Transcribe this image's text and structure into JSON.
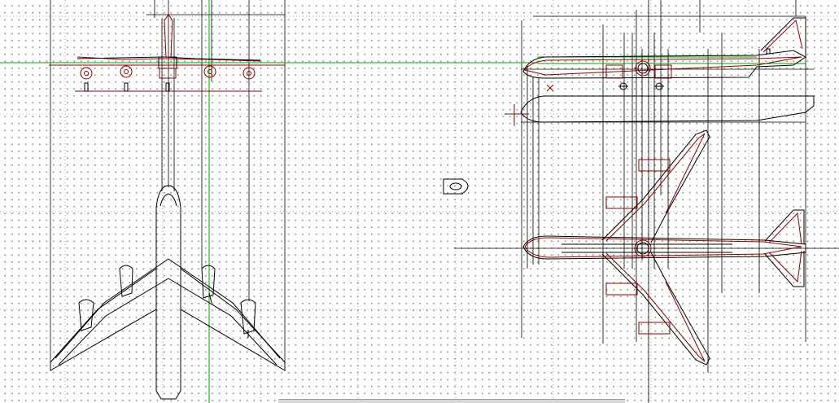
{
  "viewport": {
    "background": "#ffffff",
    "grid_color": "#9a9a9a",
    "line_colors": {
      "outline": "#000000",
      "model": "#8b0000",
      "axis": "#00a000"
    },
    "cursor": "crosshair-cursor"
  },
  "scrollbar": {
    "visible": true
  }
}
